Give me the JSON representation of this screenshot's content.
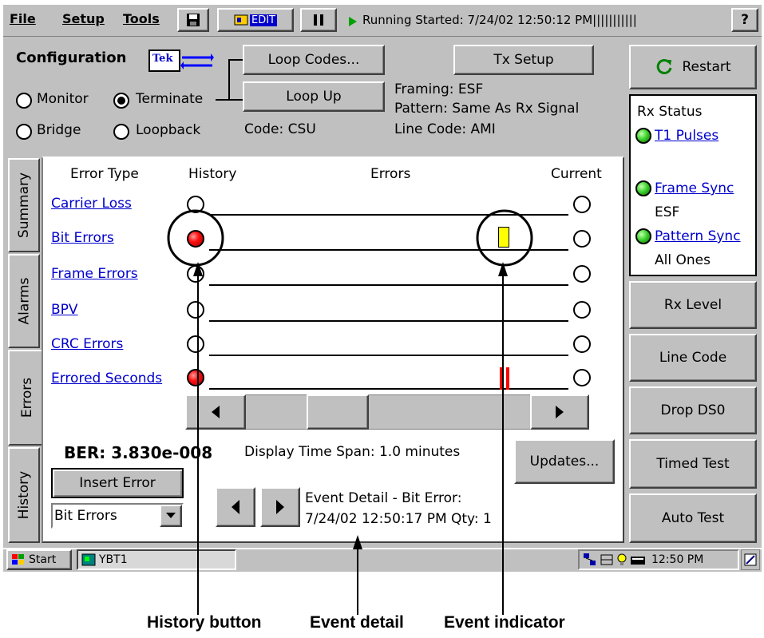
{
  "menu": {
    "file": "File",
    "setup": "Setup",
    "tools": "Tools",
    "help": "?"
  },
  "toolbar": {
    "edit_label": "EDIT",
    "status_text": "Running Started: 7/24/02 12:50:12 PM|||||||||||"
  },
  "config": {
    "title": "Configuration",
    "logo_text": "Tek",
    "modes": [
      {
        "label": "Monitor",
        "selected": false
      },
      {
        "label": "Terminate",
        "selected": true
      },
      {
        "label": "Bridge",
        "selected": false
      },
      {
        "label": "Loopback",
        "selected": false
      }
    ],
    "loop_codes_label": "Loop Codes...",
    "loop_up_label": "Loop Up",
    "code_text": "Code: CSU",
    "tx_setup_label": "Tx Setup",
    "framing": "Framing: ESF",
    "pattern": "Pattern: Same As Rx Signal",
    "line_code": "Line Code:  AMI"
  },
  "right_panel": {
    "restart_label": "Restart",
    "rx_status_title": "Rx Status",
    "rx_items": [
      {
        "label": "T1 Pulses",
        "sub": ""
      },
      {
        "label": "Frame Sync",
        "sub": "ESF"
      },
      {
        "label": "Pattern Sync",
        "sub": "All Ones"
      }
    ],
    "buttons": [
      "Rx Level",
      "Line Code",
      "Drop DS0",
      "Timed Test",
      "Auto Test"
    ]
  },
  "tabs": [
    "Summary",
    "Alarms",
    "Errors",
    "History"
  ],
  "errors_panel": {
    "headers": {
      "type": "Error Type",
      "history": "History",
      "errors": "Errors",
      "current": "Current"
    },
    "rows": [
      {
        "label": "Carrier Loss",
        "history": "off"
      },
      {
        "label": "Bit Errors",
        "history": "red"
      },
      {
        "label": "Frame Errors",
        "history": "off"
      },
      {
        "label": "BPV",
        "history": "off"
      },
      {
        "label": "CRC Errors",
        "history": "off"
      },
      {
        "label": "Errored Seconds",
        "history": "red"
      }
    ],
    "ber": "BER: 3.830e-008",
    "time_span": "Display Time Span: 1.0 minutes",
    "updates_label": "Updates...",
    "insert_error_label": "Insert Error",
    "error_select_value": "Bit Errors",
    "event_detail_line1": "Event Detail - Bit Error:",
    "event_detail_line2": "7/24/02 12:50:17 PM Qty: 1"
  },
  "taskbar": {
    "start_label": "Start",
    "app_label": "YBT1",
    "clock": "12:50 PM"
  },
  "callouts": {
    "history_button": "History button",
    "event_detail": "Event detail",
    "event_indicator": "Event indicator"
  },
  "colors": {
    "window_gray": "#c0c0c0",
    "link_blue": "#0000cc",
    "alarm_red": "#ff1010",
    "ok_green": "#3fd430",
    "event_yellow": "#ffff00"
  }
}
